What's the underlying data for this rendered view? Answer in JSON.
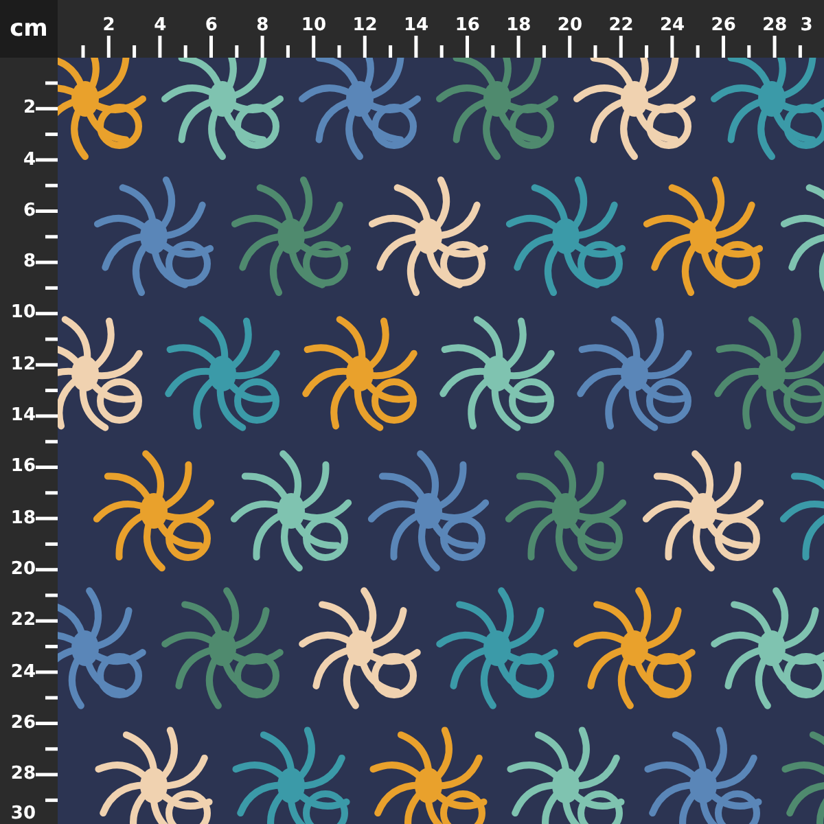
{
  "ruler": {
    "unit": "cm",
    "top_labels": [
      "2",
      "4",
      "6",
      "8",
      "10",
      "12",
      "14",
      "16",
      "18",
      "20",
      "22",
      "24",
      "26",
      "28",
      "3"
    ],
    "left_labels": [
      "2",
      "4",
      "6",
      "8",
      "10",
      "12",
      "14",
      "16",
      "18",
      "20",
      "22",
      "24",
      "26",
      "28",
      "30"
    ]
  }
}
